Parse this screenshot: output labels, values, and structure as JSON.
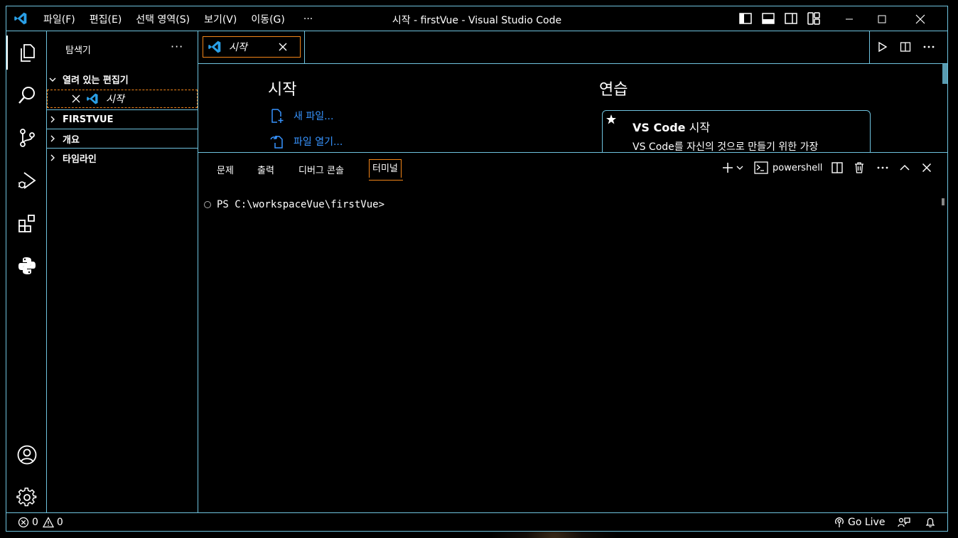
{
  "window": {
    "title": "시작 - firstVue - Visual Studio Code"
  },
  "menu": [
    "파일(F)",
    "편집(E)",
    "선택 영역(S)",
    "보기(V)",
    "이동(G)",
    "···"
  ],
  "sidebar": {
    "title": "탐색기",
    "more": "···",
    "sections": {
      "open_editors": "열려 있는 편집기",
      "firstvue": "FIRSTVUE",
      "outline": "개요",
      "timeline": "타임라인"
    },
    "open_editor_item": "시작"
  },
  "editor": {
    "tab_label": "시작",
    "start_heading": "시작",
    "practice_heading": "연습",
    "new_file": "새 파일...",
    "open_file": "파일 열기...",
    "card_title_bold": "VS Code",
    "card_title_rest": " 시작",
    "card_desc": "VS Code를 자신의 것으로 만들기 위한 가장"
  },
  "panel": {
    "tabs": [
      "문제",
      "출력",
      "디버그 콘솔",
      "터미널"
    ],
    "active_tab": "터미널",
    "shell_name": "powershell",
    "prompt": "PS C:\\workspaceVue\\firstVue>"
  },
  "status": {
    "errors": "0",
    "warnings": "0",
    "go_live": "Go Live"
  },
  "colors": {
    "border": "#6fc3df",
    "active_outline": "#f38518",
    "link": "#3794ff",
    "background": "#000000"
  }
}
